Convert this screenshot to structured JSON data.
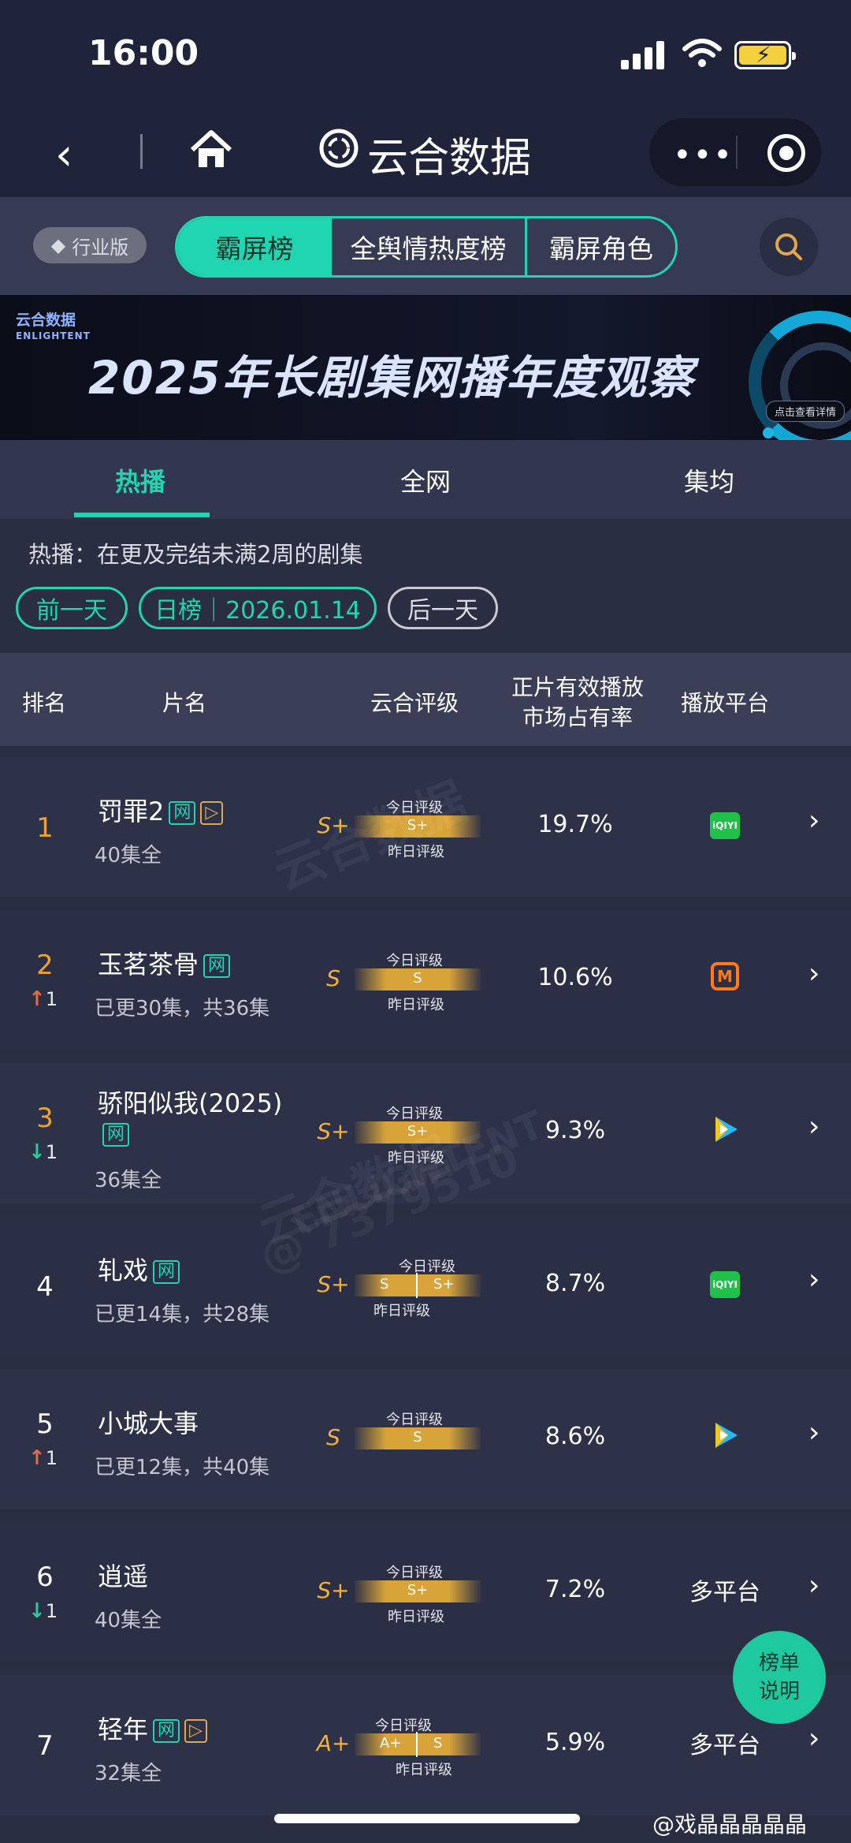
{
  "status": {
    "time": "16:00"
  },
  "nav": {
    "title": "云合数据",
    "more": "•••"
  },
  "tabs": {
    "badge": "行业版",
    "items": [
      "霸屏榜",
      "全舆情热度榜",
      "霸屏角色"
    ]
  },
  "banner": {
    "logo": "云合数据",
    "logo_en": "ENLIGHTENT",
    "title": "2025年长剧集网播年度观察",
    "detail": "点击查看详情"
  },
  "subtabs": [
    "热播",
    "全网",
    "集均"
  ],
  "desc": "热播：在更及完结未满2周的剧集",
  "date_nav": {
    "prev": "前一天",
    "current": "日榜｜2026.01.14",
    "next": "后一天"
  },
  "table": {
    "headers": {
      "rank": "排名",
      "name": "片名",
      "grade": "云合评级",
      "share_1": "正片有效播放",
      "share_2": "市场占有率",
      "platform": "播放平台"
    },
    "today_label": "今日评级",
    "yesterday_label": "昨日评级",
    "rows": [
      {
        "rank": "1",
        "name": "罚罪2",
        "tags": [
          "网",
          "▷"
        ],
        "episodes": "40集全",
        "grade": "S+",
        "bar_today": "S+",
        "share": "19.7%",
        "platform_icon": "iqiyi-icon",
        "platform_text": "iQIYI"
      },
      {
        "rank": "2",
        "change": "1",
        "direction": "up",
        "name": "玉茗茶骨",
        "tags": [
          "网"
        ],
        "episodes": "已更30集，共36集",
        "grade": "S",
        "bar_today": "S",
        "share": "10.6%",
        "platform_icon": "mango-icon",
        "platform_text": "M"
      },
      {
        "rank": "3",
        "change": "1",
        "direction": "down",
        "name": "骄阳似我(2025)",
        "tags": [
          "网"
        ],
        "episodes": "36集全",
        "grade": "S+",
        "bar_today": "S+",
        "share": "9.3%",
        "platform_icon": "tencent-video-icon"
      },
      {
        "rank": "4",
        "name": "轧戏",
        "tags": [
          "网"
        ],
        "episodes": "已更14集，共28集",
        "grade": "S+",
        "bar_left": "S",
        "bar_right": "S+",
        "share": "8.7%",
        "platform_icon": "iqiyi-icon",
        "platform_text": "iQIYI"
      },
      {
        "rank": "5",
        "change": "1",
        "direction": "up",
        "name": "小城大事",
        "tags": [],
        "episodes": "已更12集，共40集",
        "grade": "S",
        "bar_today": "S",
        "share": "8.6%",
        "platform_icon": "tencent-video-icon"
      },
      {
        "rank": "6",
        "change": "1",
        "direction": "down",
        "name": "逍遥",
        "tags": [],
        "episodes": "40集全",
        "grade": "S+",
        "bar_today": "S+",
        "share": "7.2%",
        "platform_text": "多平台"
      },
      {
        "rank": "7",
        "name": "轻年",
        "tags": [
          "网",
          "▷"
        ],
        "episodes": "32集全",
        "grade": "A+",
        "bar_left": "A+",
        "bar_right": "S",
        "share": "5.9%",
        "platform_text": "多平台"
      }
    ]
  },
  "float_button": {
    "line1": "榜单",
    "line2": "说明"
  },
  "watermark_user": "@戏晶晶晶晶晶",
  "watermarks": [
    "云合数据",
    "ENLIGHTENT",
    "@ 7379510"
  ],
  "colors": {
    "accent": "#1fd6b0",
    "grade": "#f0b040",
    "bar": "#d8a43a",
    "up": "#e46a44",
    "down": "#2dc99a"
  }
}
